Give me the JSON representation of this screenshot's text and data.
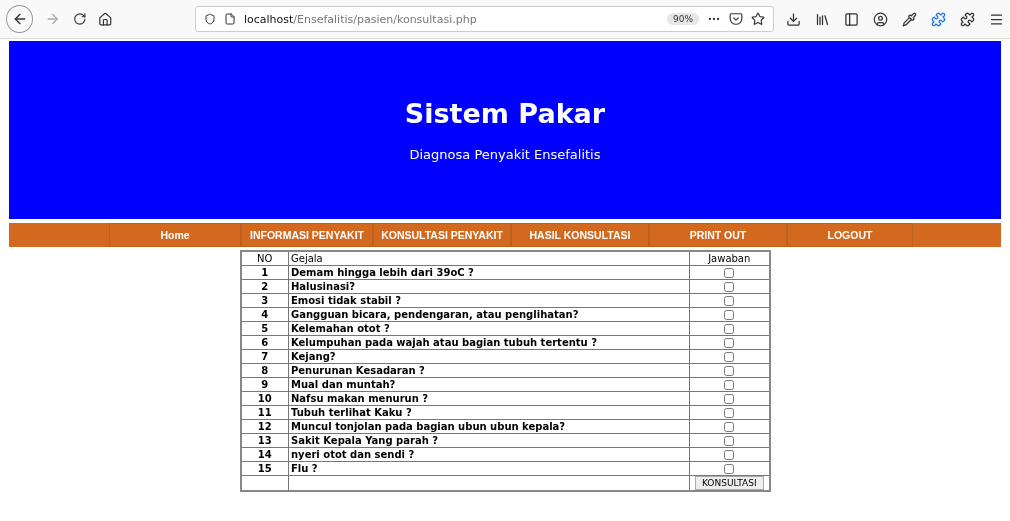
{
  "browser": {
    "url_host": "localhost",
    "url_path": "/Ensefalitis/pasien/konsultasi.php",
    "zoom": "90%"
  },
  "header": {
    "title": "Sistem Pakar",
    "subtitle": "Diagnosa Penyakit Ensefalitis"
  },
  "nav": [
    {
      "label": "Home"
    },
    {
      "label": "INFORMASI PENYAKIT"
    },
    {
      "label": "KONSULTASI PENYAKIT"
    },
    {
      "label": "HASIL KONSULTASI"
    },
    {
      "label": "PRINT OUT"
    },
    {
      "label": "LOGOUT"
    }
  ],
  "table": {
    "columns": [
      "NO",
      "Gejala",
      "Jawaban"
    ],
    "rows": [
      {
        "no": "1",
        "gejala": "Demam hingga lebih dari 39oC ?",
        "checked": false
      },
      {
        "no": "2",
        "gejala": "Halusinasi?",
        "checked": false
      },
      {
        "no": "3",
        "gejala": "Emosi tidak stabil ?",
        "checked": false
      },
      {
        "no": "4",
        "gejala": "Gangguan bicara, pendengaran, atau penglihatan?",
        "checked": false
      },
      {
        "no": "5",
        "gejala": "Kelemahan otot ?",
        "checked": false
      },
      {
        "no": "6",
        "gejala": "Kelumpuhan pada wajah atau bagian tubuh tertentu ?",
        "checked": false
      },
      {
        "no": "7",
        "gejala": "Kejang?",
        "checked": false
      },
      {
        "no": "8",
        "gejala": "Penurunan Kesadaran ?",
        "checked": false
      },
      {
        "no": "9",
        "gejala": "Mual dan muntah?",
        "checked": false
      },
      {
        "no": "10",
        "gejala": "Nafsu makan menurun ?",
        "checked": false
      },
      {
        "no": "11",
        "gejala": "Tubuh terlihat Kaku ?",
        "checked": false
      },
      {
        "no": "12",
        "gejala": "Muncul tonjolan pada bagian ubun ubun kepala?",
        "checked": false
      },
      {
        "no": "13",
        "gejala": "Sakit Kepala Yang parah ?",
        "checked": false
      },
      {
        "no": "14",
        "gejala": "nyeri otot dan sendi ?",
        "checked": false
      },
      {
        "no": "15",
        "gejala": "Flu ?",
        "checked": false
      }
    ],
    "submit": "KONSULTASI"
  }
}
